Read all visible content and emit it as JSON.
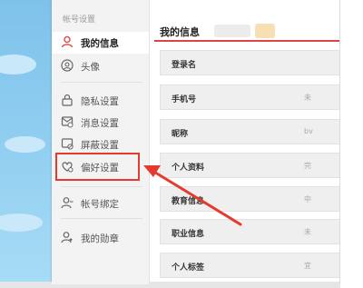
{
  "sidebar": {
    "title": "帐号设置",
    "items": [
      {
        "label": "我的信息",
        "icon": "user-icon"
      },
      {
        "label": "头像",
        "icon": "avatar-icon"
      },
      {
        "label": "隐私设置",
        "icon": "lock-icon"
      },
      {
        "label": "消息设置",
        "icon": "message-icon"
      },
      {
        "label": "屏蔽设置",
        "icon": "block-icon"
      },
      {
        "label": "偏好设置",
        "icon": "heart-settings-icon"
      },
      {
        "label": "帐号绑定",
        "icon": "user-bind-icon"
      },
      {
        "label": "我的勋章",
        "icon": "medal-icon"
      }
    ]
  },
  "main": {
    "title": "我的信息",
    "rows": [
      {
        "label": "登录名",
        "value": ""
      },
      {
        "label": "手机号",
        "value": "未"
      },
      {
        "label": "昵称",
        "value": "bv"
      },
      {
        "label": "个人资料",
        "value": "完"
      },
      {
        "label": "教育信息",
        "value": "中"
      },
      {
        "label": "职业信息",
        "value": "未"
      },
      {
        "label": "个人标签",
        "value": "宜"
      }
    ]
  },
  "colors": {
    "accent": "#e53a2d",
    "sky": "#8fcdf0",
    "sidebar_bg": "#f3f3f3",
    "row_bg": "#efefef"
  }
}
